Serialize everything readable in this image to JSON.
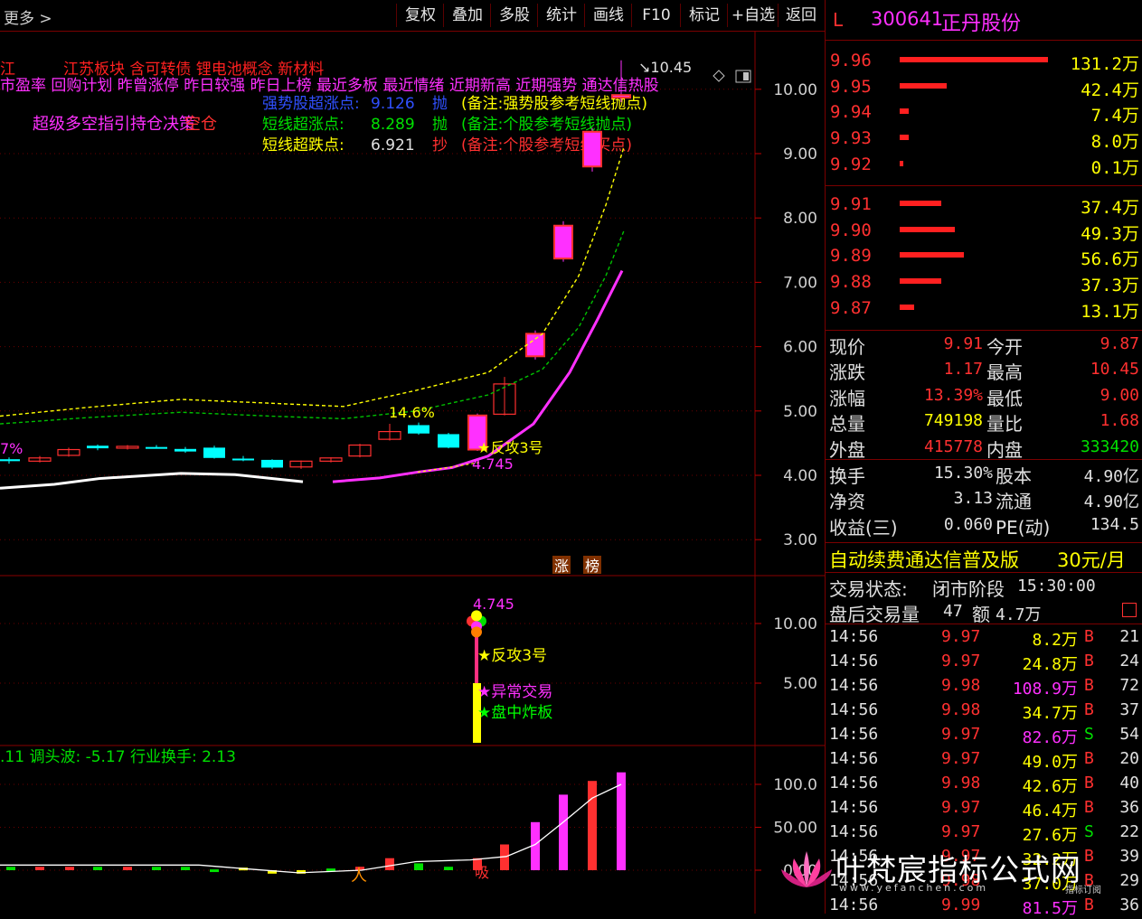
{
  "toolbar": {
    "more": "更多 >",
    "buttons": [
      "复权",
      "叠加",
      "多股",
      "统计",
      "画线",
      "F10",
      "标记",
      "+自选",
      "返回"
    ]
  },
  "header": {
    "market_flag": "L",
    "code": "300641",
    "name": "正丹股份"
  },
  "ask_levels": [
    {
      "price": "9.96",
      "vol": "131.2万",
      "frac": 1.0
    },
    {
      "price": "9.95",
      "vol": "42.4万",
      "frac": 0.32
    },
    {
      "price": "9.94",
      "vol": "7.4万",
      "frac": 0.06
    },
    {
      "price": "9.93",
      "vol": "8.0万",
      "frac": 0.06
    },
    {
      "price": "9.92",
      "vol": "0.1万",
      "frac": 0.02
    }
  ],
  "bid_levels": [
    {
      "price": "9.91",
      "vol": "37.4万",
      "frac": 0.28
    },
    {
      "price": "9.90",
      "vol": "49.3万",
      "frac": 0.37
    },
    {
      "price": "9.89",
      "vol": "56.6万",
      "frac": 0.43
    },
    {
      "price": "9.88",
      "vol": "37.3万",
      "frac": 0.28
    },
    {
      "price": "9.87",
      "vol": "13.1万",
      "frac": 0.1
    }
  ],
  "quote": [
    {
      "l1": "现价",
      "v1": "9.91",
      "c1": "red",
      "l2": "今开",
      "v2": "9.87",
      "c2": "red"
    },
    {
      "l1": "涨跌",
      "v1": "1.17",
      "c1": "red",
      "l2": "最高",
      "v2": "10.45",
      "c2": "red"
    },
    {
      "l1": "涨幅",
      "v1": "13.39%",
      "c1": "red",
      "l2": "最低",
      "v2": "9.00",
      "c2": "red"
    },
    {
      "l1": "总量",
      "v1": "749198",
      "c1": "yellow",
      "l2": "量比",
      "v2": "1.68",
      "c2": "red"
    },
    {
      "l1": "外盘",
      "v1": "415778",
      "c1": "red",
      "l2": "内盘",
      "v2": "333420",
      "c2": "green"
    }
  ],
  "fund": [
    {
      "l1": "换手",
      "v1": "15.30%",
      "l2": "股本",
      "v2": "4.90亿"
    },
    {
      "l1": "净资",
      "v1": "3.13",
      "l2": "流通",
      "v2": "4.90亿"
    },
    {
      "l1": "收益(三)",
      "v1": "0.060",
      "l2": "PE(动)",
      "v2": "134.5"
    }
  ],
  "ad": {
    "text": "自动续费通达信普及版",
    "price": "30元/月"
  },
  "trade_status": {
    "label": "交易状态:",
    "value": "闭市阶段",
    "time": "15:30:00"
  },
  "after_hours": {
    "label": "盘后交易量",
    "vol": "47",
    "amt_label": "额",
    "amt": "4.7万"
  },
  "ticks": [
    {
      "t": "14:56",
      "p": "9.97",
      "v": "8.2万",
      "bs": "B",
      "n": "21",
      "vc": "yellow"
    },
    {
      "t": "14:56",
      "p": "9.97",
      "v": "24.8万",
      "bs": "B",
      "n": "24",
      "vc": "yellow"
    },
    {
      "t": "14:56",
      "p": "9.98",
      "v": "108.9万",
      "bs": "B",
      "n": "72",
      "vc": "mag"
    },
    {
      "t": "14:56",
      "p": "9.98",
      "v": "34.7万",
      "bs": "B",
      "n": "37",
      "vc": "yellow"
    },
    {
      "t": "14:56",
      "p": "9.97",
      "v": "82.6万",
      "bs": "S",
      "n": "54",
      "vc": "mag"
    },
    {
      "t": "14:56",
      "p": "9.97",
      "v": "49.0万",
      "bs": "B",
      "n": "20",
      "vc": "yellow"
    },
    {
      "t": "14:56",
      "p": "9.98",
      "v": "42.6万",
      "bs": "B",
      "n": "40",
      "vc": "yellow"
    },
    {
      "t": "14:56",
      "p": "9.97",
      "v": "46.4万",
      "bs": "B",
      "n": "36",
      "vc": "yellow"
    },
    {
      "t": "14:56",
      "p": "9.97",
      "v": "27.6万",
      "bs": "S",
      "n": "22",
      "vc": "yellow"
    },
    {
      "t": "14:56",
      "p": "9.97",
      "v": "32.2万",
      "bs": "B",
      "n": "39",
      "vc": "yellow"
    },
    {
      "t": "14:56",
      "p": "9.98",
      "v": "37.0万",
      "bs": "B",
      "n": "29",
      "vc": "yellow"
    },
    {
      "t": "14:56",
      "p": "9.99",
      "v": "81.5万",
      "bs": "B",
      "n": "36",
      "vc": "mag"
    }
  ],
  "main_chart": {
    "y_ticks": [
      "10.00",
      "9.00",
      "8.00",
      "7.00",
      "6.00",
      "5.00",
      "4.00",
      "3.00"
    ],
    "concept_line1": [
      "江苏板块",
      "含可转债",
      "锂电池概念",
      "新材料"
    ],
    "concept_line2": "市盈率 回购计划 昨曾涨停 昨日较强 昨日上榜 最近多板 最近情绪 近期新高 近期强势 通达信热股",
    "concept_prefix": "江",
    "left_pct": "7%",
    "super_label": "超级多空指引持仓决策",
    "super_label2": "空仓",
    "points": [
      {
        "name": "强势股超涨点:",
        "value": "9.126",
        "action": "抛",
        "note": "(备注:强势股参考短线抛点)",
        "color": "#3050ff",
        "ncolor": "#ffff00"
      },
      {
        "name": "短线超涨点:",
        "value": "8.289",
        "action": "抛",
        "note": "(备注:个股参考短线抛点)",
        "color": "#00e000",
        "ncolor": "#00e000"
      },
      {
        "name": "短线超跌点:",
        "value": "6.921",
        "action": "抄",
        "note": "(备注:个股参考短线买点)",
        "color": "#ffff00",
        "ncolor": "#ff3030"
      }
    ],
    "high_label": "10.45",
    "pct_label": "14.6%",
    "fangong": "反攻3号",
    "low_label": "4.745",
    "tags": [
      "涨",
      "榜"
    ]
  },
  "sub_chart": {
    "y_ticks": [
      "10.00",
      "5.00"
    ],
    "label_top": "4.745",
    "signals": [
      "反攻3号",
      "异常交易",
      "盘中炸板"
    ]
  },
  "bottom_chart": {
    "y_ticks": [
      "100.0",
      "50.00",
      "0.00"
    ],
    "header": ".11 调头波: -5.17 行业换手: 2.13",
    "xi_label": "吸"
  },
  "watermark": {
    "cn": "叶梵宸指标公式网",
    "en": "www.yefanchen.com",
    "sub": "指标订阅"
  }
}
